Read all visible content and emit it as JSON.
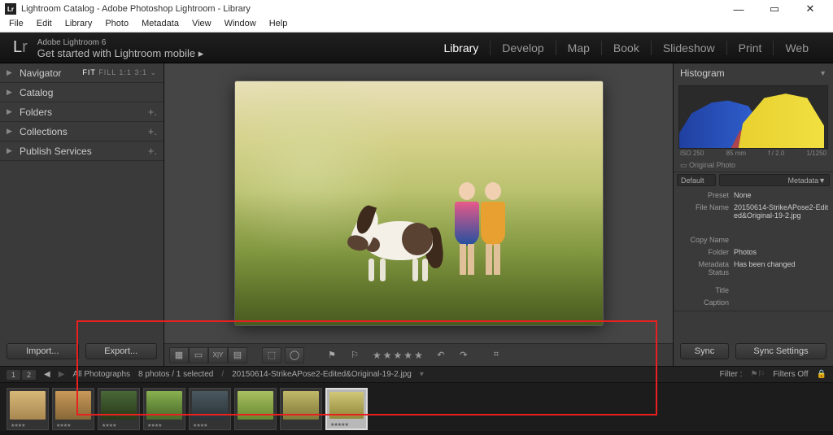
{
  "titlebar": {
    "app_icon": "Lr",
    "title": "Lightroom Catalog - Adobe Photoshop Lightroom - Library"
  },
  "menu": [
    "File",
    "Edit",
    "Library",
    "Photo",
    "Metadata",
    "View",
    "Window",
    "Help"
  ],
  "header": {
    "logo_a": "L",
    "logo_b": "r",
    "brand_small": "Adobe Lightroom 6",
    "brand_sub": "Get started with Lightroom mobile  ▸",
    "modules": [
      "Library",
      "Develop",
      "Map",
      "Book",
      "Slideshow",
      "Print",
      "Web"
    ],
    "active_module": "Library"
  },
  "left_panels": {
    "navigator": {
      "label": "Navigator",
      "sub_fit": "FIT",
      "sub_fill": "FILL",
      "sub_11": "1:1",
      "sub_31": "3:1 ⌄"
    },
    "catalog": {
      "label": "Catalog"
    },
    "folders": {
      "label": "Folders"
    },
    "collections": {
      "label": "Collections"
    },
    "publish": {
      "label": "Publish Services"
    }
  },
  "left_buttons": {
    "import": "Import...",
    "export": "Export..."
  },
  "right_panels": {
    "histogram_label": "Histogram",
    "histo_labels": {
      "iso": "ISO 250",
      "focal": "85 mm",
      "ap": "f / 2.0",
      "sp": "1/1250"
    },
    "original_photo": "Original Photo",
    "metadata_label": "Metadata",
    "meta_default": "Default",
    "meta": {
      "preset_k": "Preset",
      "preset_v": "None",
      "filename_k": "File Name",
      "filename_v": "20150614-StrikeAPose2-Edited&Original-19-2.jpg",
      "copyname_k": "Copy Name",
      "copyname_v": "",
      "folder_k": "Folder",
      "folder_v": "Photos",
      "status_k": "Metadata Status",
      "status_v": "Has been changed",
      "title_k": "Title",
      "title_v": "",
      "caption_k": "Caption",
      "caption_v": ""
    }
  },
  "right_buttons": {
    "sync": "Sync",
    "sync_settings": "Sync Settings"
  },
  "secondary": {
    "tab1": "1",
    "tab2": "2",
    "source": "All Photographs",
    "count": "8 photos / 1 selected",
    "filename": "20150614-StrikeAPose2-Edited&Original-19-2.jpg",
    "filter_label": "Filter :",
    "filters_off": "Filters Off"
  },
  "toolbar": {
    "star": "★"
  }
}
